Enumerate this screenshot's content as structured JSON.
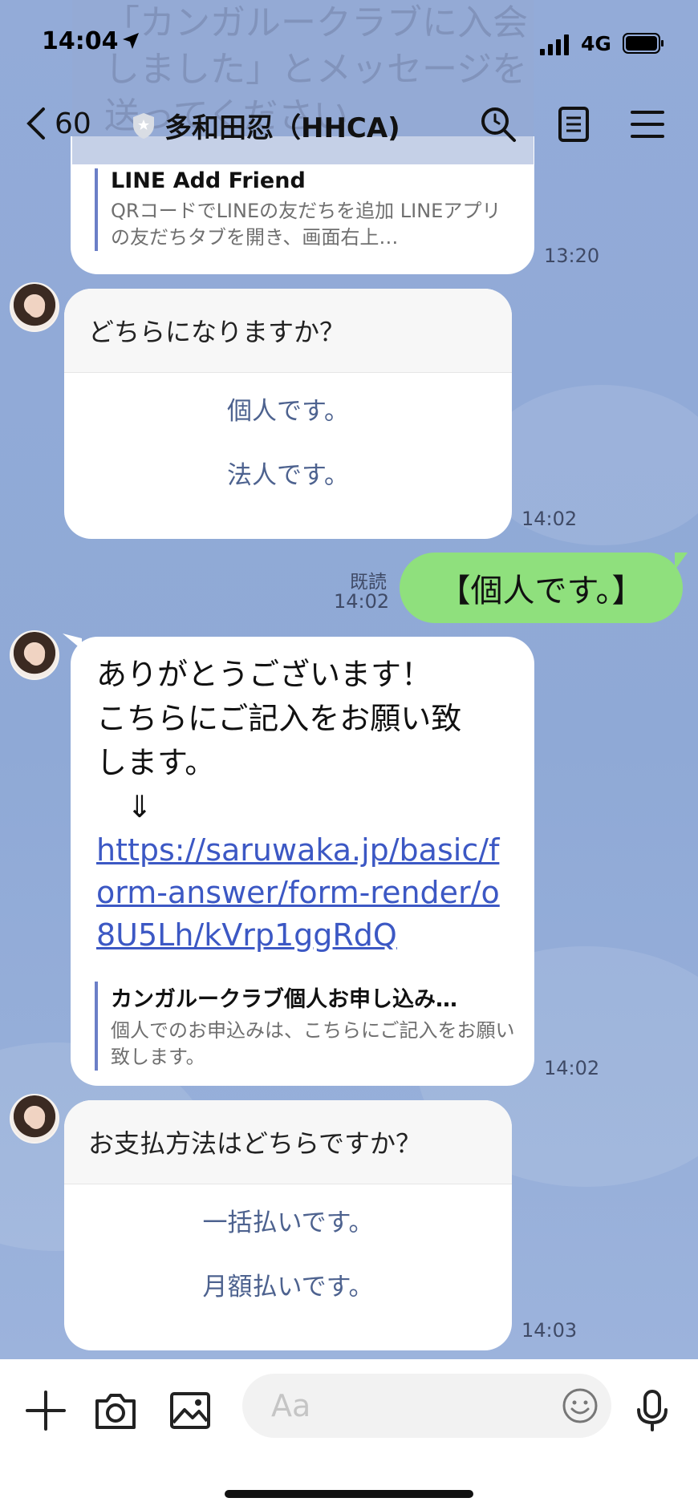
{
  "status_bar": {
    "time": "14:04",
    "network": "4G"
  },
  "header": {
    "back_count": "60",
    "title": "多和田忍（HHCA)",
    "ghost_text": "「カンガルークラブに入会しました」とメッセージを送ってください"
  },
  "messages": {
    "link_preview_1": {
      "title": "LINE Add Friend",
      "desc": "QRコードでLINEの友だちを追加 LINEアプリの友だちタブを開き、画面右上…",
      "time": "13:20"
    },
    "question_1": {
      "prompt": "どちらになりますか？",
      "options": [
        "個人です。",
        "法人です。"
      ],
      "time": "14:02"
    },
    "outgoing_1": {
      "text": "【個人です。】",
      "read_label": "既読",
      "time": "14:02"
    },
    "reply_1": {
      "line1": "ありがとうございます！",
      "line2": "こちらにご記入をお願い致",
      "line3": "します。",
      "arrow": "⇓",
      "link": "https://saruwaka.jp/basic/form-answer/form-render/o8U5Lh/kVrp1ggRdQ",
      "preview_title": "カンガルークラブ個人お申し込み…",
      "preview_desc": "個人でのお申込みは、こちらにご記入をお願い致します。",
      "time": "14:02"
    },
    "question_2": {
      "prompt": "お支払方法はどちらですか？",
      "options": [
        "一括払いです。",
        "月額払いです。"
      ],
      "time": "14:03"
    }
  },
  "input": {
    "placeholder": "Aa"
  },
  "colors": {
    "accent_link": "#3c58c4",
    "bubble_out": "#8fe07d",
    "chat_bg": "#8fa9d6",
    "option_text": "#4d628f"
  }
}
